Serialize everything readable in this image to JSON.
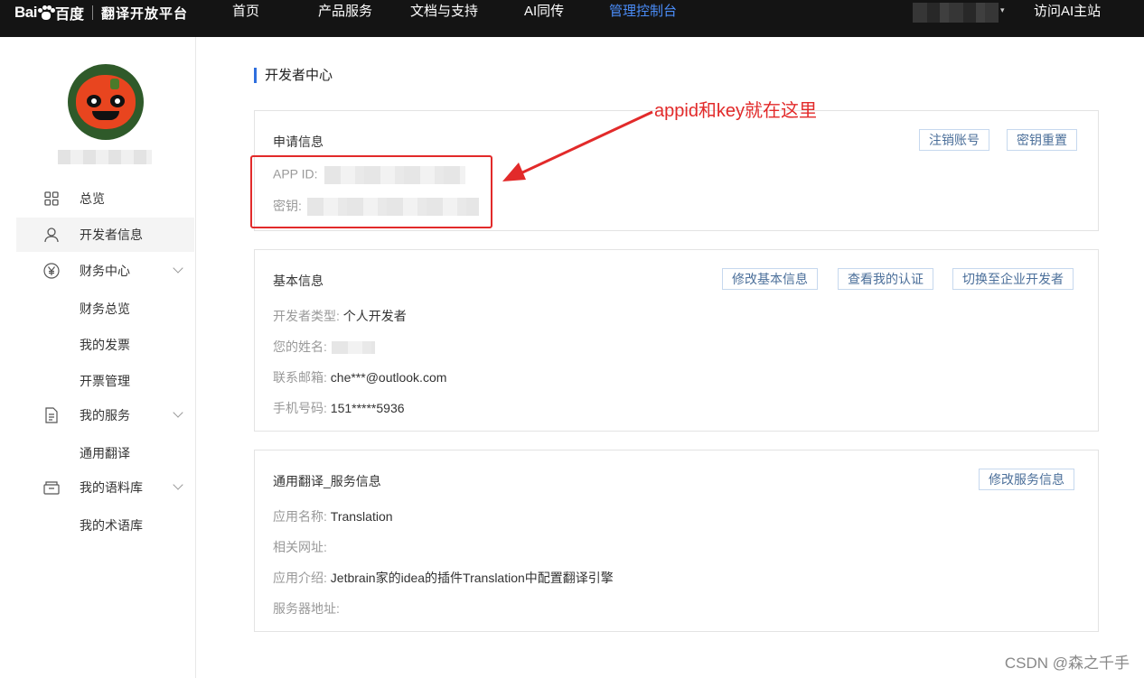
{
  "topbar": {
    "logo_bai": "Bai",
    "logo_du": "百度",
    "logo_sub": "翻译开放平台",
    "nav": [
      "首页",
      "产品服务",
      "文档与支持",
      "AI同传",
      "管理控制台"
    ],
    "active_nav": "管理控制台",
    "visit_home": "访问AI主站"
  },
  "sidebar": {
    "items": [
      {
        "label": "总览",
        "icon": "grid-icon"
      },
      {
        "label": "开发者信息",
        "icon": "user-icon"
      },
      {
        "label": "财务中心",
        "icon": "yen-icon"
      },
      {
        "label": "财务总览"
      },
      {
        "label": "我的发票"
      },
      {
        "label": "开票管理"
      },
      {
        "label": "我的服务",
        "icon": "document-icon"
      },
      {
        "label": "通用翻译"
      },
      {
        "label": "我的语料库",
        "icon": "archive-icon"
      },
      {
        "label": "我的术语库"
      }
    ]
  },
  "main": {
    "page_title": "开发者中心",
    "apply_info": {
      "title": "申请信息",
      "cancel_account": "注销账号",
      "reset_key": "密钥重置",
      "app_id_label": "APP ID:",
      "key_label": "密钥:"
    },
    "basic_info": {
      "title": "基本信息",
      "edit_basic": "修改基本信息",
      "view_cert": "查看我的认证",
      "switch_enterprise": "切换至企业开发者",
      "dev_type_label": "开发者类型:",
      "dev_type_value": "个人开发者",
      "name_label": "您的姓名:",
      "email_label": "联系邮箱:",
      "email_value": "che***@outlook.com",
      "phone_label": "手机号码:",
      "phone_value": "151*****5936"
    },
    "service_info": {
      "title": "通用翻译_服务信息",
      "edit_service": "修改服务信息",
      "app_name_label": "应用名称:",
      "app_name_value": "Translation",
      "url_label": "相关网址:",
      "intro_label": "应用介绍:",
      "intro_value": "Jetbrain家的idea的插件Translation中配置翻译引擎",
      "server_label": "服务器地址:"
    }
  },
  "annotation": {
    "text": "appid和key就在这里",
    "color": "#e22a2a"
  },
  "watermark": "CSDN @森之千手",
  "colors": {
    "topbar_bg": "#141414",
    "active_nav": "#4a8cf7",
    "accent": "#2f6fde"
  }
}
